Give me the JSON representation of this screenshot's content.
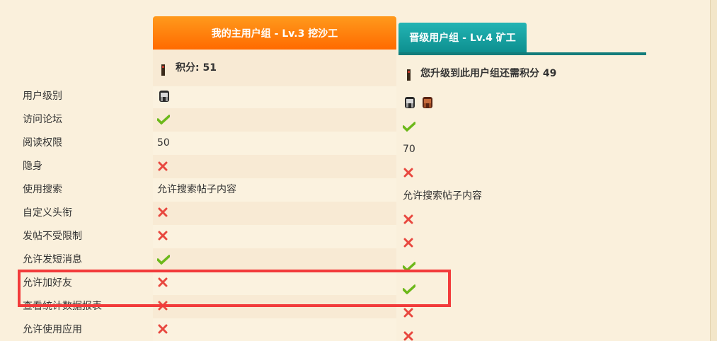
{
  "current_group": {
    "title": "我的主用户组 - Lv.3 挖沙工",
    "points_label": "积分: 51"
  },
  "next_group": {
    "title": "晋级用户组 - Lv.4 矿工",
    "upgrade_text": "您升级到此用户组还需积分 49"
  },
  "rows": [
    {
      "label": "用户级别",
      "current": "badge",
      "next": "badge2"
    },
    {
      "label": "访问论坛",
      "current": "yes",
      "next": "yes"
    },
    {
      "label": "阅读权限",
      "current": "50",
      "next": "70"
    },
    {
      "label": "隐身",
      "current": "no",
      "next": "no"
    },
    {
      "label": "使用搜索",
      "current": "允许搜索帖子内容",
      "next": "允许搜索帖子内容"
    },
    {
      "label": "自定义头衔",
      "current": "no",
      "next": "no"
    },
    {
      "label": "发帖不受限制",
      "current": "no",
      "next": "no"
    },
    {
      "label": "允许发短消息",
      "current": "yes",
      "next": "yes"
    },
    {
      "label": "允许加好友",
      "current": "no",
      "next": "yes"
    },
    {
      "label": "查看统计数据报表",
      "current": "no",
      "next": "no"
    },
    {
      "label": "允许使用应用",
      "current": "no",
      "next": "no"
    }
  ],
  "colors": {
    "current_header": "#ff7a00",
    "next_header": "#149f9f",
    "highlight": "#f23b3b",
    "check": "#6cb81a",
    "cross": "#e8483f"
  }
}
